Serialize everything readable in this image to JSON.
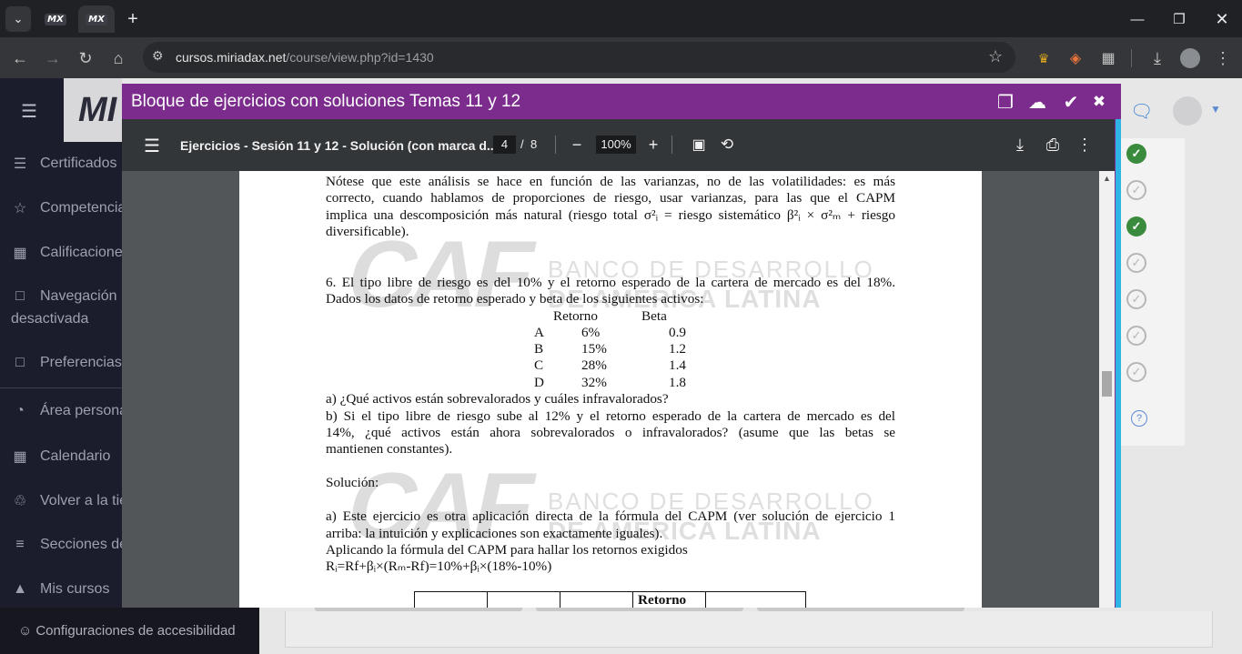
{
  "browser": {
    "tab_switcher_icon": "chevron-down-icon",
    "tabs": [
      {
        "favicon": "MX",
        "active": false
      },
      {
        "favicon": "MX",
        "active": true
      }
    ],
    "new_tab_label": "+",
    "url_host": "cursos.miriadax.net",
    "url_path": "/course/view.php?id=1430"
  },
  "sidebar": {
    "brand": "MI",
    "items": [
      {
        "label": "Certificados",
        "icon": "layers-icon"
      },
      {
        "label": "Competencias",
        "icon": "star-icon"
      },
      {
        "label": "Calificaciones",
        "icon": "gradebook-icon"
      },
      {
        "label": "Navegación",
        "label2": "desactivada",
        "icon": "folder-icon"
      },
      {
        "label": "Preferencias",
        "icon": "folder-icon"
      },
      {
        "label": "Área personal",
        "icon": "dashboard-icon"
      },
      {
        "label": "Calendario",
        "icon": "calendar-icon"
      },
      {
        "label": "Volver a la tienda",
        "icon": "cart-icon"
      },
      {
        "label": "Secciones del curso",
        "icon": "list-icon"
      },
      {
        "label": "Mis cursos",
        "icon": "graduation-cap-icon"
      }
    ],
    "accessibility": "Configuraciones de accesibilidad"
  },
  "progress_checks": [
    true,
    false,
    true,
    false,
    false,
    false,
    false
  ],
  "modal": {
    "title": "Bloque de ejercicios con soluciones Temas 11 y 12"
  },
  "pdf": {
    "doc_title": "Ejercicios - Sesión 11 y 12 - Solución (con marca d...",
    "page": "4",
    "separator": "/",
    "total_pages": "8",
    "zoom": "100%",
    "watermark_logo": "CAF",
    "watermark_line1": "BANCO DE DESARROLLO",
    "watermark_line2": "DE AMÉRICA LATINA",
    "text": {
      "p1_l1": "Nótese que este análisis se hace en función de las varianzas, no de las volatilidades: es más",
      "p1_l2": "correcto, cuando hablamos de proporciones de riesgo, usar varianzas, para las que el CAPM",
      "p1_l3": "implica una descomposición más natural (riesgo total σ²ᵢ = riesgo sistemático β²ᵢ × σ²ₘ + riesgo",
      "p1_l4": "diversificable).",
      "q6_l1": "6. El tipo libre de riesgo es del 10% y el retorno esperado de la cartera de mercado es del 18%.",
      "q6_l2": "Dados los datos de retorno esperado y beta de los siguientes activos:",
      "table_header_return": "Retorno",
      "table_header_beta": "Beta",
      "assets": [
        {
          "name": "A",
          "ret": "6%",
          "beta": "0.9"
        },
        {
          "name": "B",
          "ret": "15%",
          "beta": "1.2"
        },
        {
          "name": "C",
          "ret": "28%",
          "beta": "1.4"
        },
        {
          "name": "D",
          "ret": "32%",
          "beta": "1.8"
        }
      ],
      "qa": "a) ¿Qué activos están sobrevalorados y cuáles infravalorados?",
      "qb_l1": "b) Si el tipo libre de riesgo sube al 12% y el retorno esperado de la cartera de mercado es del",
      "qb_l2": "14%, ¿qué activos están ahora sobrevalorados o infravalorados? (asume que las betas se",
      "qb_l3": "mantienen constantes).",
      "solution_heading": "Solución:",
      "sa_l1": "a) Este ejercicio es otra aplicación directa de la fórmula del CAPM (ver solución de ejercicio 1",
      "sa_l2": "arriba: la intuición y explicaciones son exactamente iguales).",
      "sa_l3": "Aplicando la fórmula del CAPM para hallar los retornos exigidos",
      "formula": "Rᵢ=Rf+βᵢ×(Rₘ-Rf)=10%+βᵢ×(18%-10%)",
      "bottom_table_header": "Retorno"
    }
  }
}
